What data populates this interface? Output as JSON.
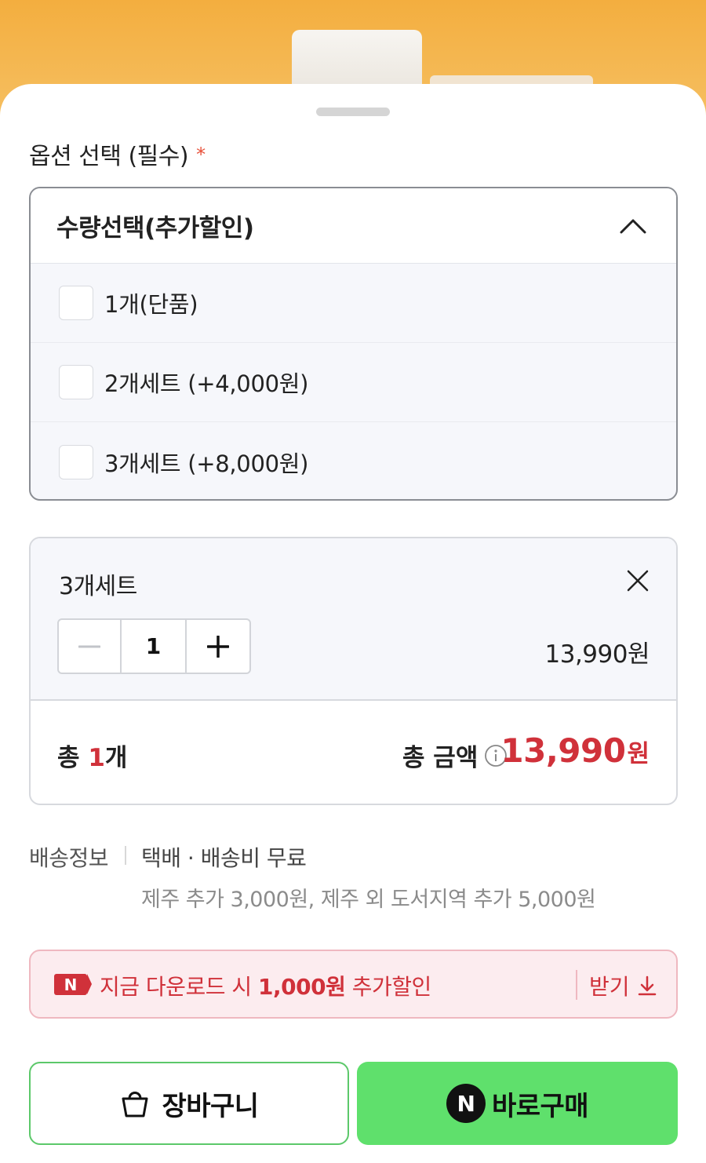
{
  "option_section": {
    "title": "옵션 선택 (필수)",
    "required_mark": "*"
  },
  "option_dropdown": {
    "label": "수량선택(추가할인)",
    "options": [
      {
        "label": "1개(단품)"
      },
      {
        "label": "2개세트 (+4,000원)"
      },
      {
        "label": "3개세트 (+8,000원)"
      }
    ]
  },
  "selected_item": {
    "name": "3개세트",
    "quantity": "1",
    "price": "13,990원"
  },
  "summary": {
    "count_prefix": "총 ",
    "count_value": "1",
    "count_suffix": "개",
    "total_label": "총 금액",
    "total_amount": "13,990",
    "total_unit": "원"
  },
  "shipping": {
    "label": "배송정보",
    "main": "택배 · 배송비 무료",
    "sub": "제주 추가 3,000원, 제주 외 도서지역 추가 5,000원"
  },
  "coupon": {
    "badge": "N",
    "text_before": "지금 다운로드 시 ",
    "text_bold": "1,000원",
    "text_after": " 추가할인",
    "action": "받기"
  },
  "actions": {
    "cart_label": "장바구니",
    "buy_badge": "N",
    "buy_label": "바로구매"
  },
  "colors": {
    "accent_red": "#d0313a",
    "buy_green": "#5fe06c",
    "cart_border_green": "#5cc86a",
    "header_orange": "#f3ae3f"
  }
}
